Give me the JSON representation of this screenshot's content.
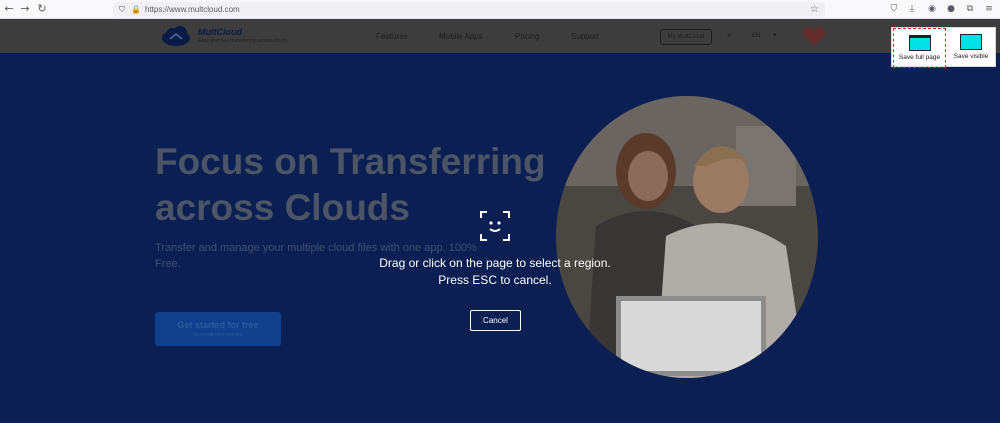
{
  "browser": {
    "url": "https://www.multcloud.com",
    "nav_icons": [
      "back-icon",
      "forward-icon",
      "reload-icon"
    ],
    "toolbar_icons": [
      "pocket-icon",
      "download-icon",
      "account-icon",
      "profile-icon",
      "extensions-icon",
      "menu-icon"
    ]
  },
  "site_nav": {
    "logo_name": "MultCloud",
    "logo_tagline": "Easy and free transferring across clouds",
    "menu": [
      "Features",
      "Mobile Apps",
      "Pricing",
      "Support"
    ],
    "account_button": "My MultCloud",
    "language": "EN"
  },
  "hero": {
    "title_line1": "Focus on Transferring",
    "title_line2": "across Clouds",
    "subtitle": "Transfer and manage your multiple cloud files with one app. 100% Free.",
    "cta_label": "Get started for free",
    "cta_note": "No credit card needed"
  },
  "overlay": {
    "message": "Drag or click on the page to select a region. Press ESC to cancel.",
    "cancel_label": "Cancel",
    "save_full_label": "Save full page",
    "save_visible_label": "Save visible"
  },
  "colors": {
    "hero_bg": "#0b1f53",
    "overlay_text": "#ffffff",
    "save_icon": "#00e0e8",
    "selected_outline": "#e02020"
  }
}
